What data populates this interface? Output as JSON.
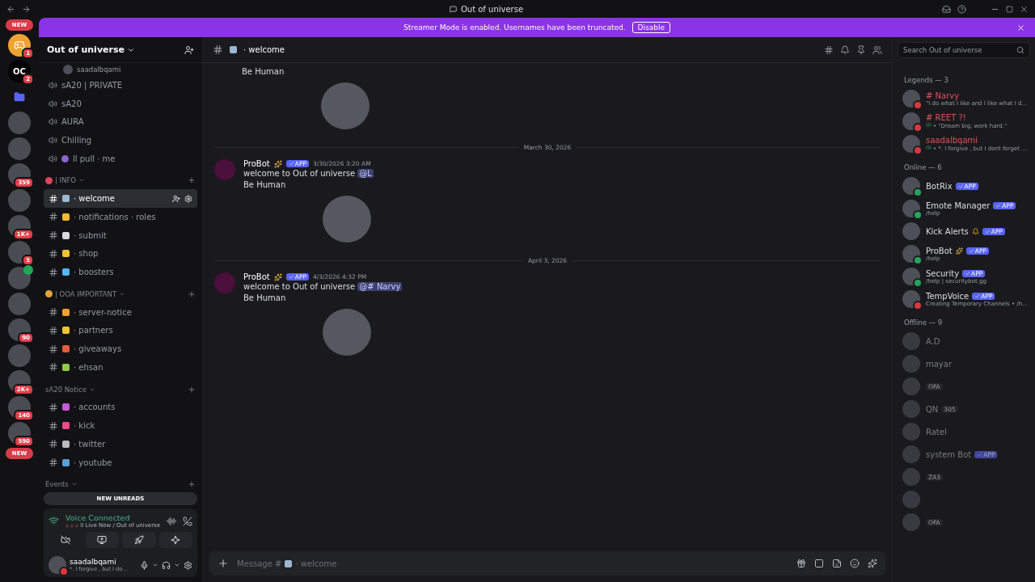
{
  "window": {
    "title": "Out of universe"
  },
  "banner": {
    "text": "Streamer Mode is enabled. Usernames have been truncated.",
    "button": "Disable"
  },
  "servers": [
    {
      "kind": "new",
      "label": "NEW"
    },
    {
      "kind": "logo",
      "badge": "1"
    },
    {
      "kind": "text",
      "label": "OC",
      "badge": "2"
    },
    {
      "kind": "folder"
    },
    {
      "kind": "avatar"
    },
    {
      "kind": "avatar"
    },
    {
      "kind": "avatar",
      "badge": "359"
    },
    {
      "kind": "avatar"
    },
    {
      "kind": "avatar",
      "badge": "1K+"
    },
    {
      "kind": "avatar",
      "badge": "5"
    },
    {
      "kind": "avatar",
      "voice": true
    },
    {
      "kind": "avatar"
    },
    {
      "kind": "avatar",
      "badge": "90"
    },
    {
      "kind": "avatar"
    },
    {
      "kind": "avatar",
      "badge": "2K+"
    },
    {
      "kind": "avatar",
      "badge": "140"
    },
    {
      "kind": "avatar",
      "badge": "590"
    },
    {
      "kind": "new",
      "label": "NEW"
    }
  ],
  "server": {
    "name": "Out of universe"
  },
  "channels": [
    {
      "kind": "user",
      "name": "saadalbqami"
    },
    {
      "kind": "voice",
      "name": "sA20 | PRIVATE"
    },
    {
      "kind": "voice",
      "name": "sA20"
    },
    {
      "kind": "voice",
      "name": "AURA"
    },
    {
      "kind": "voice",
      "name": "Chilling"
    },
    {
      "kind": "voice",
      "name": "ll pull · me",
      "color": "#8a63d2"
    },
    {
      "kind": "category",
      "name": "| INFO",
      "color": "#e0405a"
    },
    {
      "kind": "text",
      "name": "· welcome",
      "color": "#9bb7d4",
      "selected": true
    },
    {
      "kind": "text",
      "name": "· notifications · roles",
      "color": "#f5b82e",
      "selected": false
    },
    {
      "kind": "text",
      "name": "· submit",
      "color": "#d9d9d9",
      "selected": false
    },
    {
      "kind": "text",
      "name": "· shop",
      "color": "#f2c230",
      "selected": false
    },
    {
      "kind": "text",
      "name": "· boosters",
      "color": "#4fb8f0",
      "selected": false
    },
    {
      "kind": "category",
      "name": "| OOA IMPORTANT",
      "color": "#e8a33a"
    },
    {
      "kind": "text",
      "name": "· server-notice",
      "color": "#f0a030",
      "selected": false
    },
    {
      "kind": "text",
      "name": "· partners",
      "color": "#f2c230",
      "selected": false
    },
    {
      "kind": "text",
      "name": "· giveaways",
      "color": "#e85a3a",
      "selected": false
    },
    {
      "kind": "text",
      "name": "· ehsan",
      "color": "#8fc94a",
      "selected": false
    },
    {
      "kind": "category",
      "name": "sA20 Notice"
    },
    {
      "kind": "text",
      "name": "· accounts",
      "color": "#c85ad8",
      "selected": false
    },
    {
      "kind": "text",
      "name": "· kick",
      "color": "#e84a8a",
      "selected": false
    },
    {
      "kind": "text",
      "name": "· twitter",
      "color": "#bbbbbb",
      "selected": false
    },
    {
      "kind": "text",
      "name": "· youtube",
      "color": "#5aa0d8",
      "selected": false
    },
    {
      "kind": "category",
      "name": "Events"
    }
  ],
  "new_unreads": "NEW UNREADS",
  "voice": {
    "title": "Voice Connected",
    "detail": "ll Live Now / Out of universe"
  },
  "user": {
    "name": "saadalbqami",
    "status": "*. I forgive , but I do..."
  },
  "chat": {
    "channel": "· welcome",
    "search_placeholder": "Search Out of universe"
  },
  "messages": [
    {
      "kind": "continued",
      "lines": [
        "Be Human"
      ]
    },
    {
      "kind": "divider",
      "date": "March 30, 2026"
    },
    {
      "kind": "message",
      "author": "ProBot",
      "badge": "APP",
      "time": "3/30/2026 3:20 AM",
      "text": "welcome to Out of universe",
      "mention": "@L",
      "lines": [
        "Be Human"
      ]
    },
    {
      "kind": "divider",
      "date": "April 3, 2026"
    },
    {
      "kind": "message",
      "author": "ProBot",
      "badge": "APP",
      "time": "4/3/2026 4:32 PM",
      "text": "welcome to Out of universe",
      "mention": "@# Narvy",
      "lines": [
        "Be Human"
      ]
    }
  ],
  "composer": {
    "placeholder_start": "Message #",
    "placeholder_end": "· welcome"
  },
  "member_groups": [
    {
      "title": "Legends — 3",
      "members": [
        {
          "name": "# Narvy",
          "color": "#da373c",
          "highlighted": true,
          "offline": false,
          "activity": "\"I do what I like and I like what I d..."
        },
        {
          "name": "# REET ?!",
          "color": "#da373c",
          "highlighted": true,
          "offline": false,
          "activity": "• \"Dream big, work hard.\"",
          "voice": true
        },
        {
          "name": "saadalbqami",
          "color": "#da373c",
          "highlighted": true,
          "offline": false,
          "activity": "• *. I forgive , but I dont forget ....",
          "voice": true
        }
      ]
    },
    {
      "title": "Online — 6",
      "members": [
        {
          "name": "BotRix",
          "color": "#23a55a",
          "offline": false,
          "badge": "APP"
        },
        {
          "name": "Emote Manager",
          "color": "#23a55a",
          "offline": false,
          "badge": "APP",
          "activity": "/help"
        },
        {
          "name": "Kick Alerts",
          "offline": false,
          "badge": "APP",
          "bell": true
        },
        {
          "name": "ProBot",
          "color": "#23a55a",
          "offline": false,
          "badge": "APP",
          "activity": "/help",
          "sparkle": true
        },
        {
          "name": "Security",
          "color": "#23a55a",
          "offline": false,
          "badge": "APP",
          "activity": "/help | securitybot.gg"
        },
        {
          "name": "TempVoice",
          "color": "#da373c",
          "offline": false,
          "badge": "APP",
          "activity": "Creating Temporary Channels • /h..."
        }
      ]
    },
    {
      "title": "Offline — 9",
      "members": [
        {
          "name": "A.D",
          "offline": true
        },
        {
          "name": "mayar",
          "offline": true
        },
        {
          "offline": true,
          "tag": "OFA"
        },
        {
          "name": "QN",
          "offline": true,
          "tag": "305"
        },
        {
          "name": "Ratel",
          "offline": true
        },
        {
          "name": "system Bot",
          "offline": true,
          "badge": "APP"
        },
        {
          "offline": true,
          "tag": "ZA3"
        },
        {
          "offline": true
        },
        {
          "offline": true,
          "tag": "OFA"
        }
      ]
    }
  ]
}
